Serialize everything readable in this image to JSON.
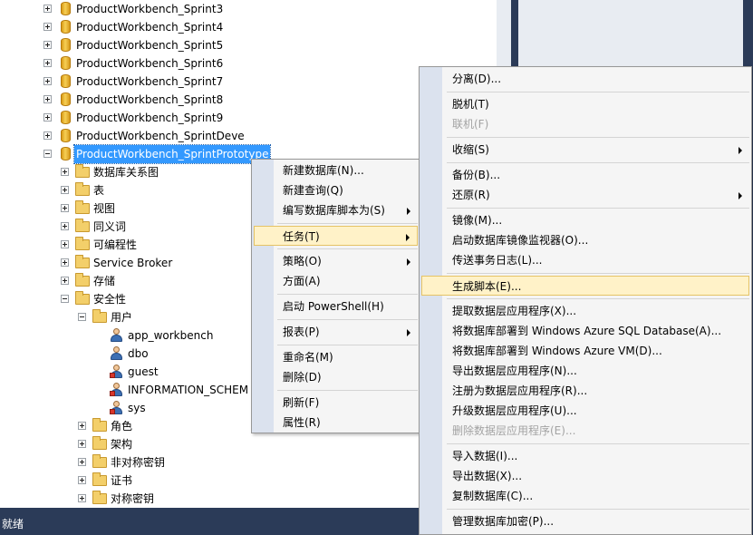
{
  "tree": {
    "databases": [
      "ProductWorkbench_Sprint3",
      "ProductWorkbench_Sprint4",
      "ProductWorkbench_Sprint5",
      "ProductWorkbench_Sprint6",
      "ProductWorkbench_Sprint7",
      "ProductWorkbench_Sprint8",
      "ProductWorkbench_Sprint9",
      "ProductWorkbench_SprintDeve",
      "ProductWorkbench_SprintPrototype"
    ],
    "db_children": [
      "数据库关系图",
      "表",
      "视图",
      "同义词",
      "可编程性",
      "Service Broker",
      "存储",
      "安全性"
    ],
    "security": {
      "users_folder": "用户",
      "users": [
        "app_workbench",
        "dbo",
        "guest",
        "INFORMATION_SCHEM",
        "sys"
      ],
      "other_folders": [
        "角色",
        "架构",
        "非对称密钥",
        "证书",
        "对称密钥"
      ]
    }
  },
  "status_bar": {
    "text": "就绪"
  },
  "context_menu": {
    "items": [
      "新建数据库(N)...",
      "新建查询(Q)",
      "编写数据库脚本为(S)",
      "任务(T)",
      "策略(O)",
      "方面(A)",
      "启动 PowerShell(H)",
      "报表(P)",
      "重命名(M)",
      "删除(D)",
      "刷新(F)",
      "属性(R)"
    ]
  },
  "tasks_submenu": {
    "items": [
      "分离(D)...",
      "脱机(T)",
      "联机(F)",
      "收缩(S)",
      "备份(B)...",
      "还原(R)",
      "镜像(M)...",
      "启动数据库镜像监视器(O)...",
      "传送事务日志(L)...",
      "生成脚本(E)...",
      "提取数据层应用程序(X)...",
      "将数据库部署到 Windows Azure SQL Database(A)...",
      "将数据库部署到 Windows Azure VM(D)...",
      "导出数据层应用程序(N)...",
      "注册为数据层应用程序(R)...",
      "升级数据层应用程序(U)...",
      "删除数据层应用程序(E)...",
      "导入数据(I)...",
      "导出数据(X)...",
      "复制数据库(C)...",
      "管理数据库加密(P)..."
    ]
  },
  "colors": {
    "selection": "#3399ff",
    "menu_highlight": "#fff2c8",
    "status_bar": "#2b3b58"
  }
}
